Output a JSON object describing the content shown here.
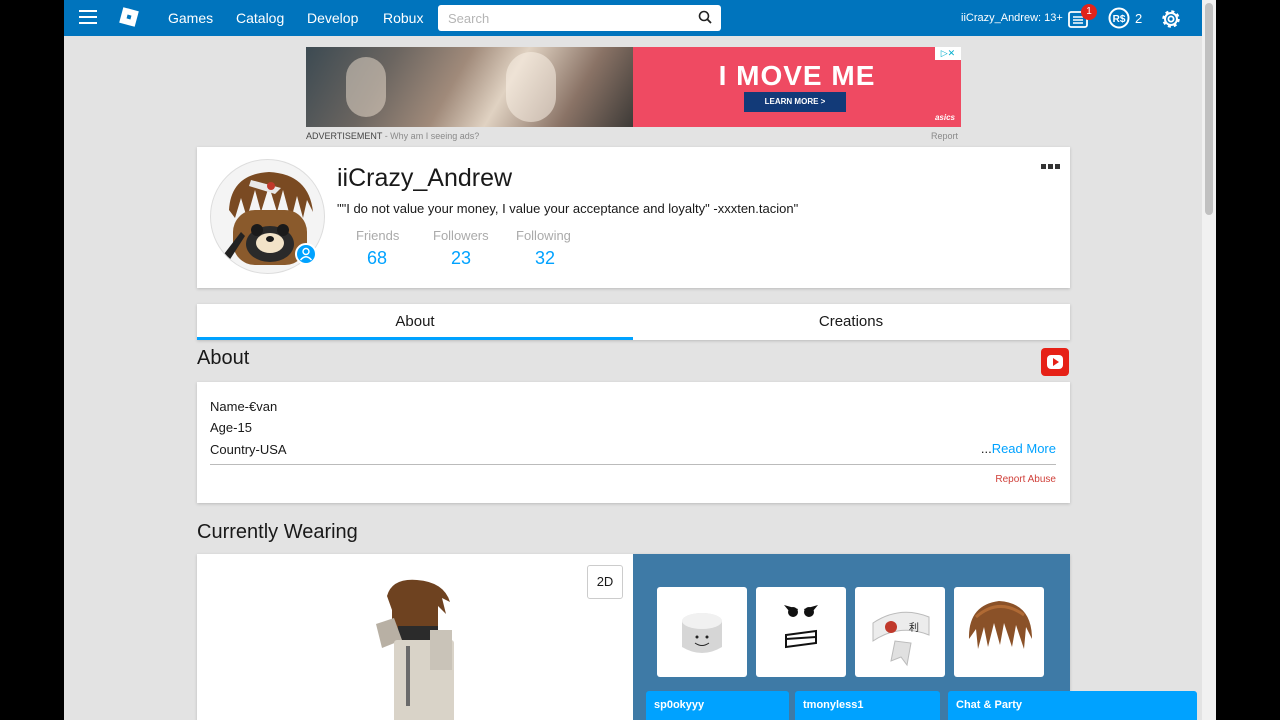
{
  "nav": {
    "links": [
      "Games",
      "Catalog",
      "Develop",
      "Robux"
    ],
    "search_placeholder": "Search",
    "user_label": "iiCrazy_Andrew: 13+",
    "message_badge": "1",
    "robux_count": "2",
    "accent_color": "#0074bd"
  },
  "ad": {
    "headline": "I MOVE ME",
    "button": "LEARN MORE >",
    "brand": "asics",
    "adchoices": "▷✕",
    "caption_label": "ADVERTISEMENT",
    "caption_why": " - Why am I seeing ads?",
    "report": "Report"
  },
  "profile": {
    "name": "iiCrazy_Andrew",
    "blurb": "\"\"I do not value your money, I value your acceptance and loyalty\" -xxxten.tacion\"",
    "stats": [
      {
        "label": "Friends",
        "value": "68"
      },
      {
        "label": "Followers",
        "value": "23"
      },
      {
        "label": "Following",
        "value": "32"
      }
    ]
  },
  "tabs": [
    "About",
    "Creations"
  ],
  "about": {
    "title": "About",
    "lines": [
      "Name-€van",
      "Age-15",
      "Country-USA"
    ],
    "read_more_dots": "...",
    "read_more": "Read More",
    "report_abuse": "Report Abuse"
  },
  "wearing": {
    "title": "Currently Wearing",
    "toggle_label": "2D",
    "items": [
      "head",
      "face",
      "headband",
      "hair"
    ]
  },
  "chat": {
    "tabs": [
      "sp0okyyy",
      "tmonyless1"
    ],
    "main": "Chat & Party"
  }
}
